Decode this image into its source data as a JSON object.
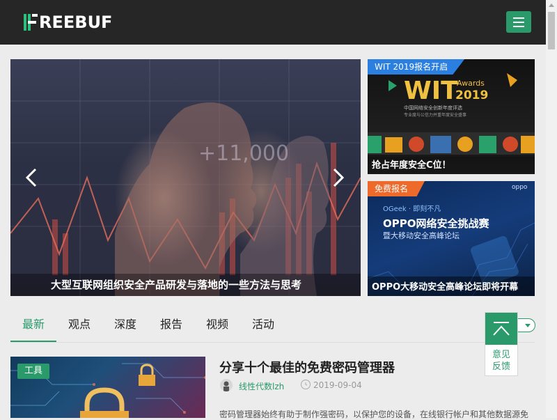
{
  "header": {
    "logo_text": "REEBUF",
    "menu_icon": "hamburger-menu-icon"
  },
  "hero": {
    "title": "大型互联网组织安全产品研发与落地的一些方法与思考",
    "overlay_text": "+11,000"
  },
  "side_cards": [
    {
      "tag": "WIT 2019报名开启",
      "title": "抢占年度安全C位！",
      "image_big_text": "WIT",
      "image_awards": "Awards",
      "image_year": "2019",
      "image_sub1": "中国网络安全创新年度评选",
      "image_sub2": "专业度与公信力并重年度安全盛事"
    },
    {
      "tag": "免费报名",
      "title": "OPPO大移动安全高峰论坛即将开幕",
      "image_brand": "oppo",
      "image_geek": "OGeek · 即刻不凡",
      "image_heading": "OPPO网络安全挑战赛",
      "image_sub": "暨大移动安全高峰论坛"
    }
  ],
  "tabs": [
    "最新",
    "观点",
    "深度",
    "报告",
    "视频",
    "活动"
  ],
  "active_tab": "最新",
  "float_widget": {
    "feedback_line1": "意见",
    "feedback_line2": "反馈"
  },
  "article": {
    "tag": "工具",
    "title": "分享十个最佳的免费密码管理器",
    "author": "线性代数lzh",
    "date": "2019-09-04",
    "excerpt": "密码管理器始终有助于制作强密码，以保护您的设备，在线银行帐户和其他数据源免"
  },
  "colors": {
    "brand_green": "#2a9a6b",
    "header_bg": "#262626",
    "tag_blue": "#2b7fe0",
    "tag_orange": "#ee6a2b"
  }
}
